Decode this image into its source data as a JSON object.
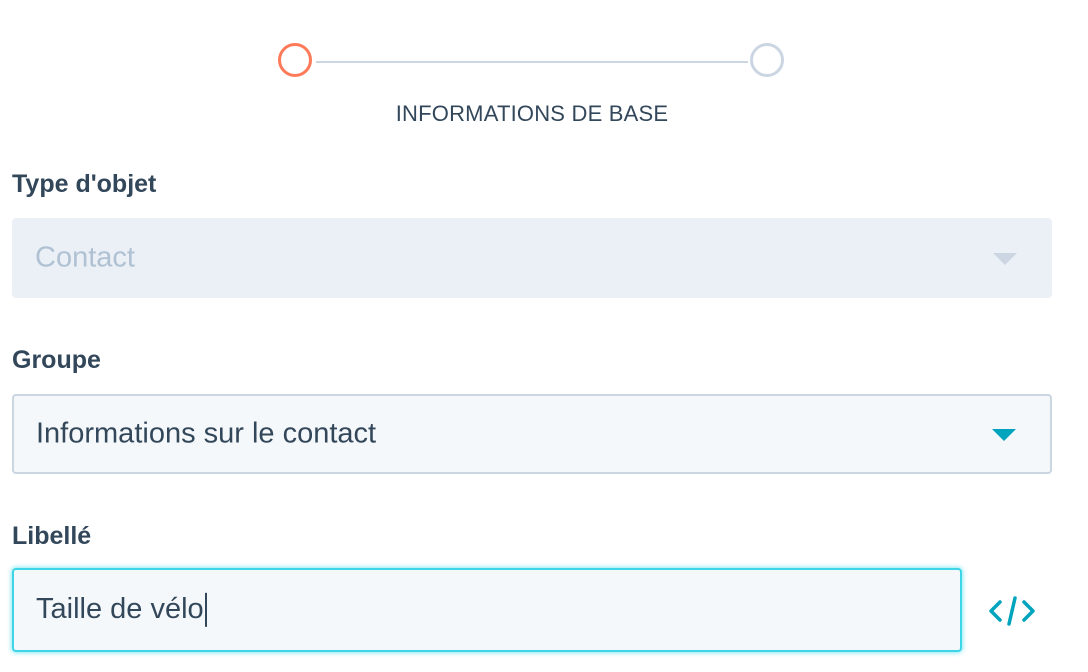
{
  "stepper": {
    "current_step": 1,
    "total_steps": 2,
    "caption": "INFORMATIONS DE BASE"
  },
  "fields": {
    "object_type": {
      "label": "Type d'objet",
      "value": "Contact",
      "disabled": true
    },
    "group": {
      "label": "Groupe",
      "value": "Informations sur le contact"
    },
    "label": {
      "label": "Libellé",
      "value": "Taille de vélo"
    }
  },
  "icons": {
    "dropdown": "chevron-down-icon",
    "code_toggle": "code-icon"
  },
  "colors": {
    "active_step": "#ff7a59",
    "inactive_step": "#cbd6e2",
    "accent": "#00a4bd",
    "focus_border": "#3ed5e6",
    "text": "#33475b",
    "disabled_text": "#b0c1d4",
    "disabled_bg": "#eaf0f6"
  }
}
